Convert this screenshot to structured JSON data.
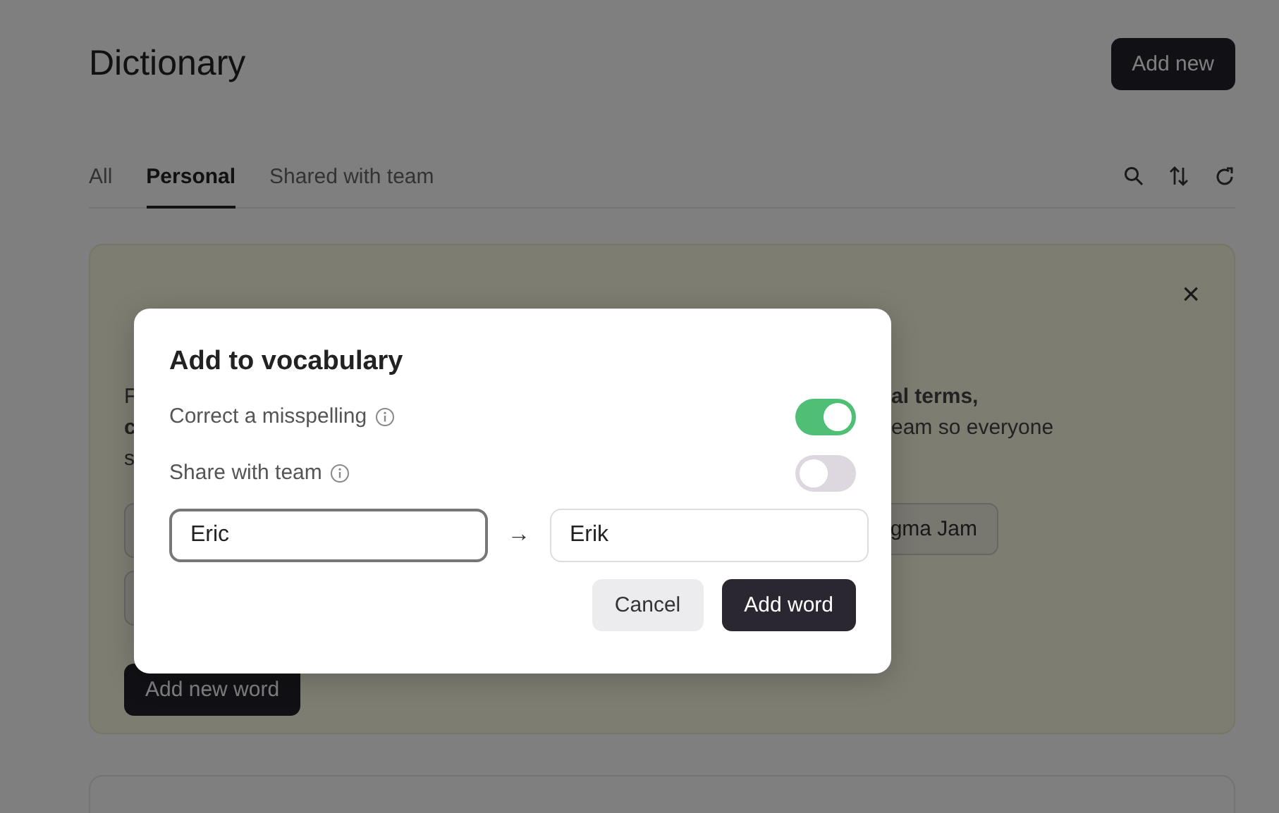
{
  "page": {
    "title": "Dictionary",
    "add_button": "Add new"
  },
  "tabs": [
    {
      "label": "All",
      "selected": false
    },
    {
      "label": "Personal",
      "selected": true
    },
    {
      "label": "Shared with team",
      "selected": false
    }
  ],
  "banner": {
    "close": "×",
    "lines": [
      {
        "left": "F",
        "right": "**al terms,**"
      },
      {
        "left": "**c**",
        "right": "eam so everyone"
      },
      {
        "left": "s"
      }
    ],
    "chip_rows": [
      {
        "right": "gma Jam"
      },
      {}
    ],
    "button": "Add new word"
  },
  "dialog": {
    "title": "Add to vocabulary",
    "toggles": [
      {
        "label": "Correct a misspelling",
        "on": true
      },
      {
        "label": "Share with team",
        "on": false
      }
    ],
    "from": {
      "value": "Eric",
      "focused": true
    },
    "arrow": "→",
    "to": {
      "value": "Erik",
      "focused": false
    },
    "buttons": [
      {
        "label": "Cancel",
        "kind": "secondary"
      },
      {
        "label": "Add word",
        "kind": "primary"
      }
    ]
  }
}
